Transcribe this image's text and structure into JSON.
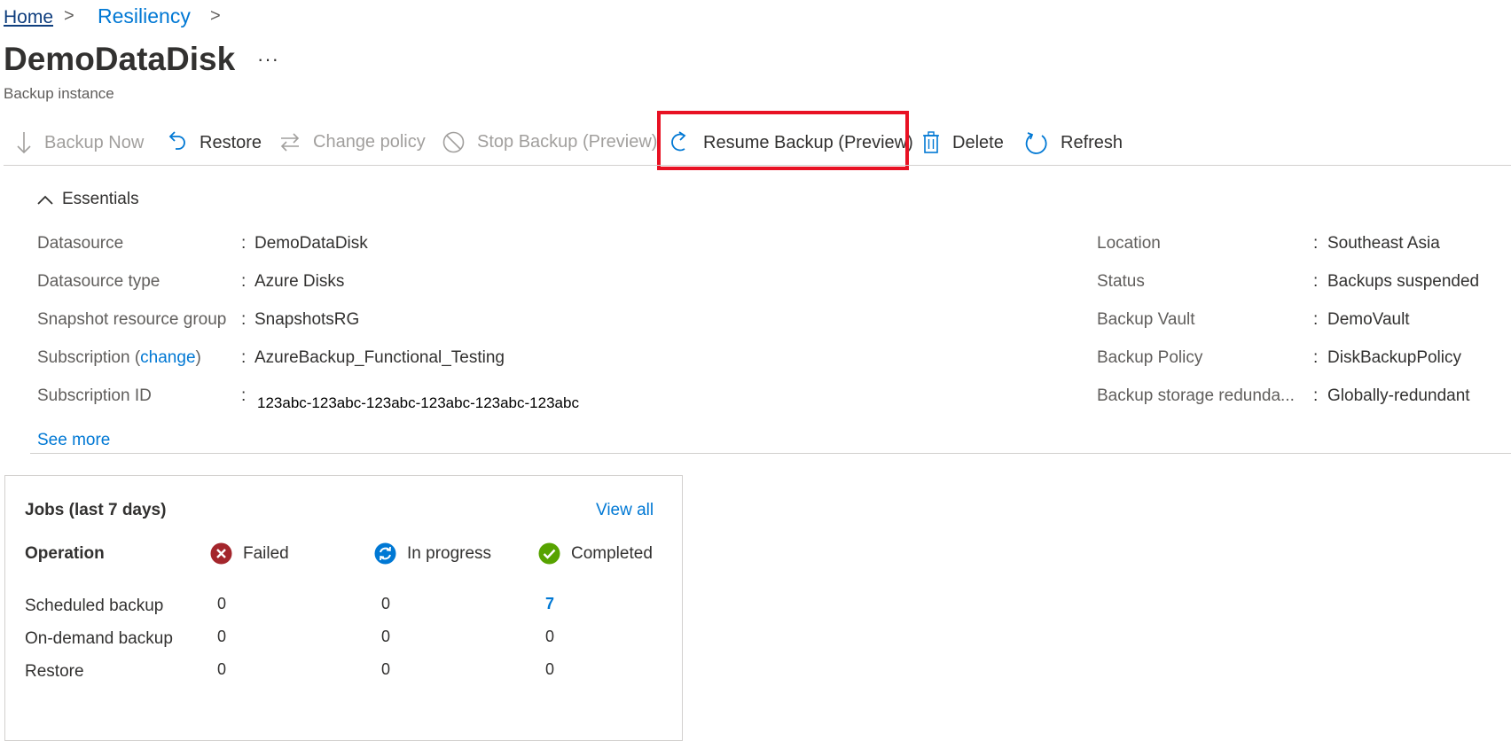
{
  "breadcrumb": {
    "home": "Home",
    "resiliency": "Resiliency",
    "separator": ">"
  },
  "page": {
    "title": "DemoDataDisk",
    "more": "···",
    "subtitle": "Backup instance"
  },
  "toolbar": {
    "backup_now": "Backup Now",
    "restore": "Restore",
    "change_policy": "Change policy",
    "stop_backup": "Stop Backup (Preview)",
    "resume_backup": "Resume Backup (Preview)",
    "delete": "Delete",
    "refresh": "Refresh"
  },
  "essentials": {
    "header": "Essentials",
    "left": [
      {
        "label": "Datasource",
        "value": "DemoDataDisk"
      },
      {
        "label": "Datasource type",
        "value": "Azure Disks"
      },
      {
        "label": "Snapshot resource group",
        "value": "SnapshotsRG"
      },
      {
        "label_prefix": "Subscription (",
        "label_link": "change",
        "label_suffix": ")",
        "value": "AzureBackup_Functional_Testing"
      },
      {
        "label": "Subscription ID",
        "value": "123abc-123abc-123abc-123abc-123abc-123abc"
      }
    ],
    "right": [
      {
        "label": "Location",
        "value": "Southeast Asia"
      },
      {
        "label": "Status",
        "value": "Backups suspended"
      },
      {
        "label": "Backup Vault",
        "value": "DemoVault"
      },
      {
        "label": "Backup Policy",
        "value": "DiskBackupPolicy"
      },
      {
        "label": "Backup storage redunda...",
        "value": "Globally-redundant"
      }
    ],
    "colon": ":",
    "see_more": "See more"
  },
  "jobs": {
    "title": "Jobs (last 7 days)",
    "view_all": "View all",
    "operation_header": "Operation",
    "status_headers": {
      "failed": "Failed",
      "in_progress": "In progress",
      "completed": "Completed"
    },
    "rows": [
      {
        "operation": "Scheduled backup",
        "failed": "0",
        "in_progress": "0",
        "completed": "7"
      },
      {
        "operation": "On-demand backup",
        "failed": "0",
        "in_progress": "0",
        "completed": "0"
      },
      {
        "operation": "Restore",
        "failed": "0",
        "in_progress": "0",
        "completed": "0"
      }
    ]
  },
  "colors": {
    "accent": "#0078d4",
    "highlight": "#e81123",
    "failed": "#a4262c",
    "in_progress": "#0078d4",
    "completed": "#57a300"
  },
  "icons": [
    "arrow-down-icon",
    "undo-icon",
    "swap-arrows-icon",
    "prohibited-icon",
    "redo-icon",
    "trash-icon",
    "refresh-icon",
    "chevron-up-icon",
    "error-icon",
    "sync-icon",
    "check-icon"
  ]
}
